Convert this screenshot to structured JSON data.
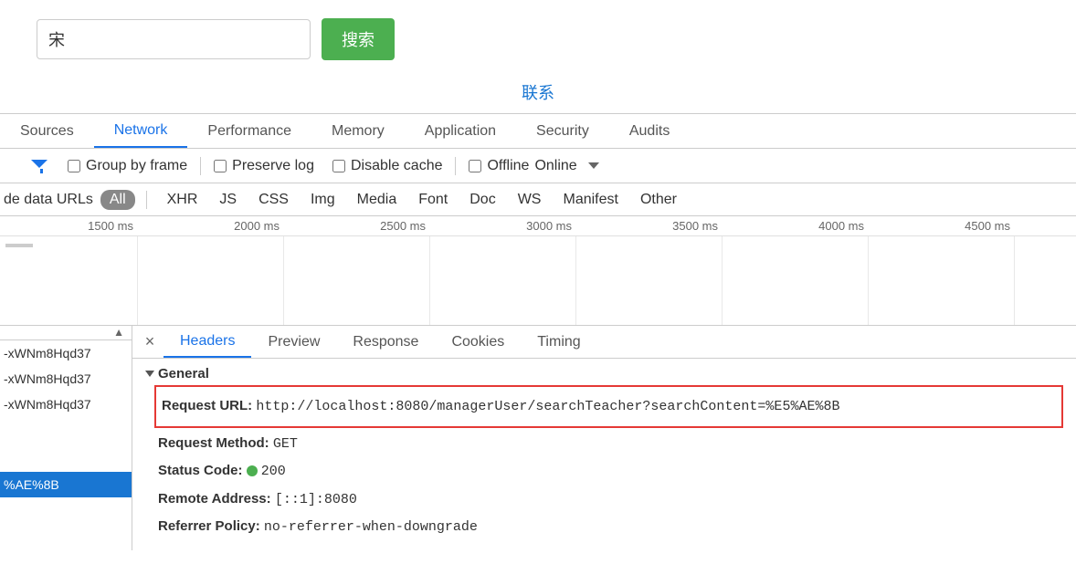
{
  "search": {
    "value": "宋",
    "button": "搜索"
  },
  "contact_link": "联系",
  "main_tabs": [
    "Sources",
    "Network",
    "Performance",
    "Memory",
    "Application",
    "Security",
    "Audits"
  ],
  "main_tab_active": "Network",
  "toolbar": {
    "group_by_frame": "Group by frame",
    "preserve_log": "Preserve log",
    "disable_cache": "Disable cache",
    "offline": "Offline",
    "online": "Online"
  },
  "filter": {
    "hide_data_urls": "de data URLs",
    "types": [
      "All",
      "XHR",
      "JS",
      "CSS",
      "Img",
      "Media",
      "Font",
      "Doc",
      "WS",
      "Manifest",
      "Other"
    ],
    "active": "All"
  },
  "timeline": {
    "ticks": [
      "1500 ms",
      "2000 ms",
      "2500 ms",
      "3000 ms",
      "3500 ms",
      "4000 ms",
      "4500 ms"
    ]
  },
  "left_items": [
    "-xWNm8Hqd37",
    "-xWNm8Hqd37",
    "-xWNm8Hqd37"
  ],
  "left_selected": "%AE%8B",
  "detail_tabs": [
    "Headers",
    "Preview",
    "Response",
    "Cookies",
    "Timing"
  ],
  "detail_tab_active": "Headers",
  "general": {
    "title": "General",
    "request_url_label": "Request URL:",
    "request_url_value": "http://localhost:8080/managerUser/searchTeacher?searchContent=%E5%AE%8B",
    "request_method_label": "Request Method:",
    "request_method_value": "GET",
    "status_code_label": "Status Code:",
    "status_code_value": "200",
    "remote_address_label": "Remote Address:",
    "remote_address_value": "[::1]:8080",
    "referrer_policy_label": "Referrer Policy:",
    "referrer_policy_value": "no-referrer-when-downgrade"
  }
}
